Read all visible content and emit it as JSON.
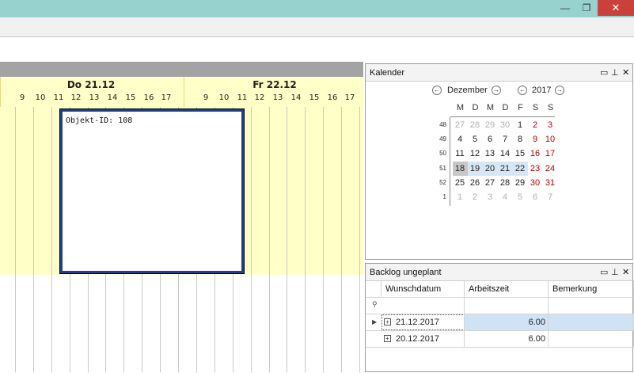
{
  "window": {
    "min_glyph": "—",
    "max_glyph": "❐",
    "close_glyph": "✕"
  },
  "scheduler": {
    "days": [
      {
        "label": "Do 21.12",
        "hours": [
          "9",
          "10",
          "11",
          "12",
          "13",
          "14",
          "15",
          "16",
          "17"
        ]
      },
      {
        "label": "Fr 22.12",
        "hours": [
          "9",
          "10",
          "11",
          "12",
          "13",
          "14",
          "15",
          "16",
          "17"
        ]
      }
    ],
    "appointment": {
      "label": "Objekt-ID: 108"
    },
    "colors": {
      "working_hours": "#ffffc8",
      "header_bar": "#a3a3a3",
      "appointment_border": "#1f3f95"
    }
  },
  "calendar_panel": {
    "title": "Kalender",
    "month": "Dezember",
    "year": "2017",
    "weekdays": [
      "M",
      "D",
      "M",
      "D",
      "F",
      "S",
      "S"
    ],
    "weeks": [
      {
        "num": "48",
        "days": [
          {
            "d": "27",
            "o": true
          },
          {
            "d": "28",
            "o": true
          },
          {
            "d": "29",
            "o": true
          },
          {
            "d": "30",
            "o": true
          },
          {
            "d": "1"
          },
          {
            "d": "2",
            "w": true
          },
          {
            "d": "3",
            "w": true
          }
        ]
      },
      {
        "num": "49",
        "days": [
          {
            "d": "4"
          },
          {
            "d": "5"
          },
          {
            "d": "6"
          },
          {
            "d": "7"
          },
          {
            "d": "8"
          },
          {
            "d": "9",
            "w": true
          },
          {
            "d": "10",
            "w": true
          }
        ]
      },
      {
        "num": "50",
        "days": [
          {
            "d": "11"
          },
          {
            "d": "12"
          },
          {
            "d": "13"
          },
          {
            "d": "14"
          },
          {
            "d": "15"
          },
          {
            "d": "16",
            "w": true
          },
          {
            "d": "17",
            "w": true
          }
        ]
      },
      {
        "num": "51",
        "days": [
          {
            "d": "18",
            "s": true,
            "t": true
          },
          {
            "d": "19",
            "s": true
          },
          {
            "d": "20",
            "s": true
          },
          {
            "d": "21",
            "s": true
          },
          {
            "d": "22",
            "s": true
          },
          {
            "d": "23",
            "w": true
          },
          {
            "d": "24",
            "w": true
          }
        ]
      },
      {
        "num": "52",
        "days": [
          {
            "d": "25"
          },
          {
            "d": "26"
          },
          {
            "d": "27"
          },
          {
            "d": "28"
          },
          {
            "d": "29"
          },
          {
            "d": "30",
            "w": true
          },
          {
            "d": "31",
            "w": true
          }
        ]
      },
      {
        "num": "1",
        "days": [
          {
            "d": "1",
            "o": true
          },
          {
            "d": "2",
            "o": true
          },
          {
            "d": "3",
            "o": true
          },
          {
            "d": "4",
            "o": true
          },
          {
            "d": "5",
            "o": true
          },
          {
            "d": "6",
            "o": true
          },
          {
            "d": "7",
            "o": true
          }
        ]
      }
    ],
    "colors": {
      "weekend": "#c00000",
      "other_month": "#b0b0b0",
      "selection": "#d5e7f4"
    }
  },
  "backlog_panel": {
    "title": "Backlog ungeplant",
    "columns": [
      "Wunschdatum",
      "Arbeitszeit",
      "Bemerkung"
    ],
    "filter_icon": "filter-icon",
    "rows": [
      {
        "wunschdatum": "21.12.2017",
        "arbeitszeit": "6.00",
        "bemerkung": "",
        "selected": true
      },
      {
        "wunschdatum": "20.12.2017",
        "arbeitszeit": "6.00",
        "bemerkung": "",
        "selected": false
      }
    ]
  }
}
